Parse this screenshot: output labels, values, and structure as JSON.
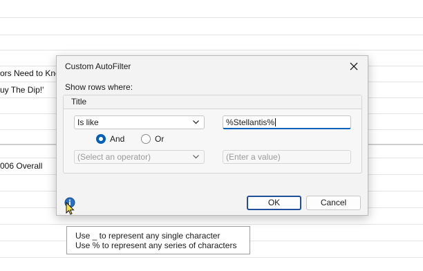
{
  "sheet": {
    "rows": [
      "ors Need to Kno",
      "uy The Dip!'",
      "006 Overall"
    ]
  },
  "dialog": {
    "title": "Custom AutoFilter",
    "show_rows_label": "Show rows where:",
    "group_label": "Title",
    "condition1": {
      "operator": "Is like",
      "value": "%Stellantis%"
    },
    "logic": {
      "and_label": "And",
      "or_label": "Or",
      "selected": "And"
    },
    "condition2": {
      "operator_placeholder": "(Select an operator)",
      "value_placeholder": "(Enter a value)"
    },
    "ok_label": "OK",
    "cancel_label": "Cancel",
    "icons": {
      "close": "close-icon",
      "info": "info-icon",
      "chevron": "chevron-down-icon"
    }
  },
  "tooltip": {
    "line1": "Use _ to represent any single character",
    "line2": "Use % to represent any series of characters"
  },
  "colors": {
    "accent": "#005fb8",
    "dialog_bg": "#f3f3f3"
  }
}
